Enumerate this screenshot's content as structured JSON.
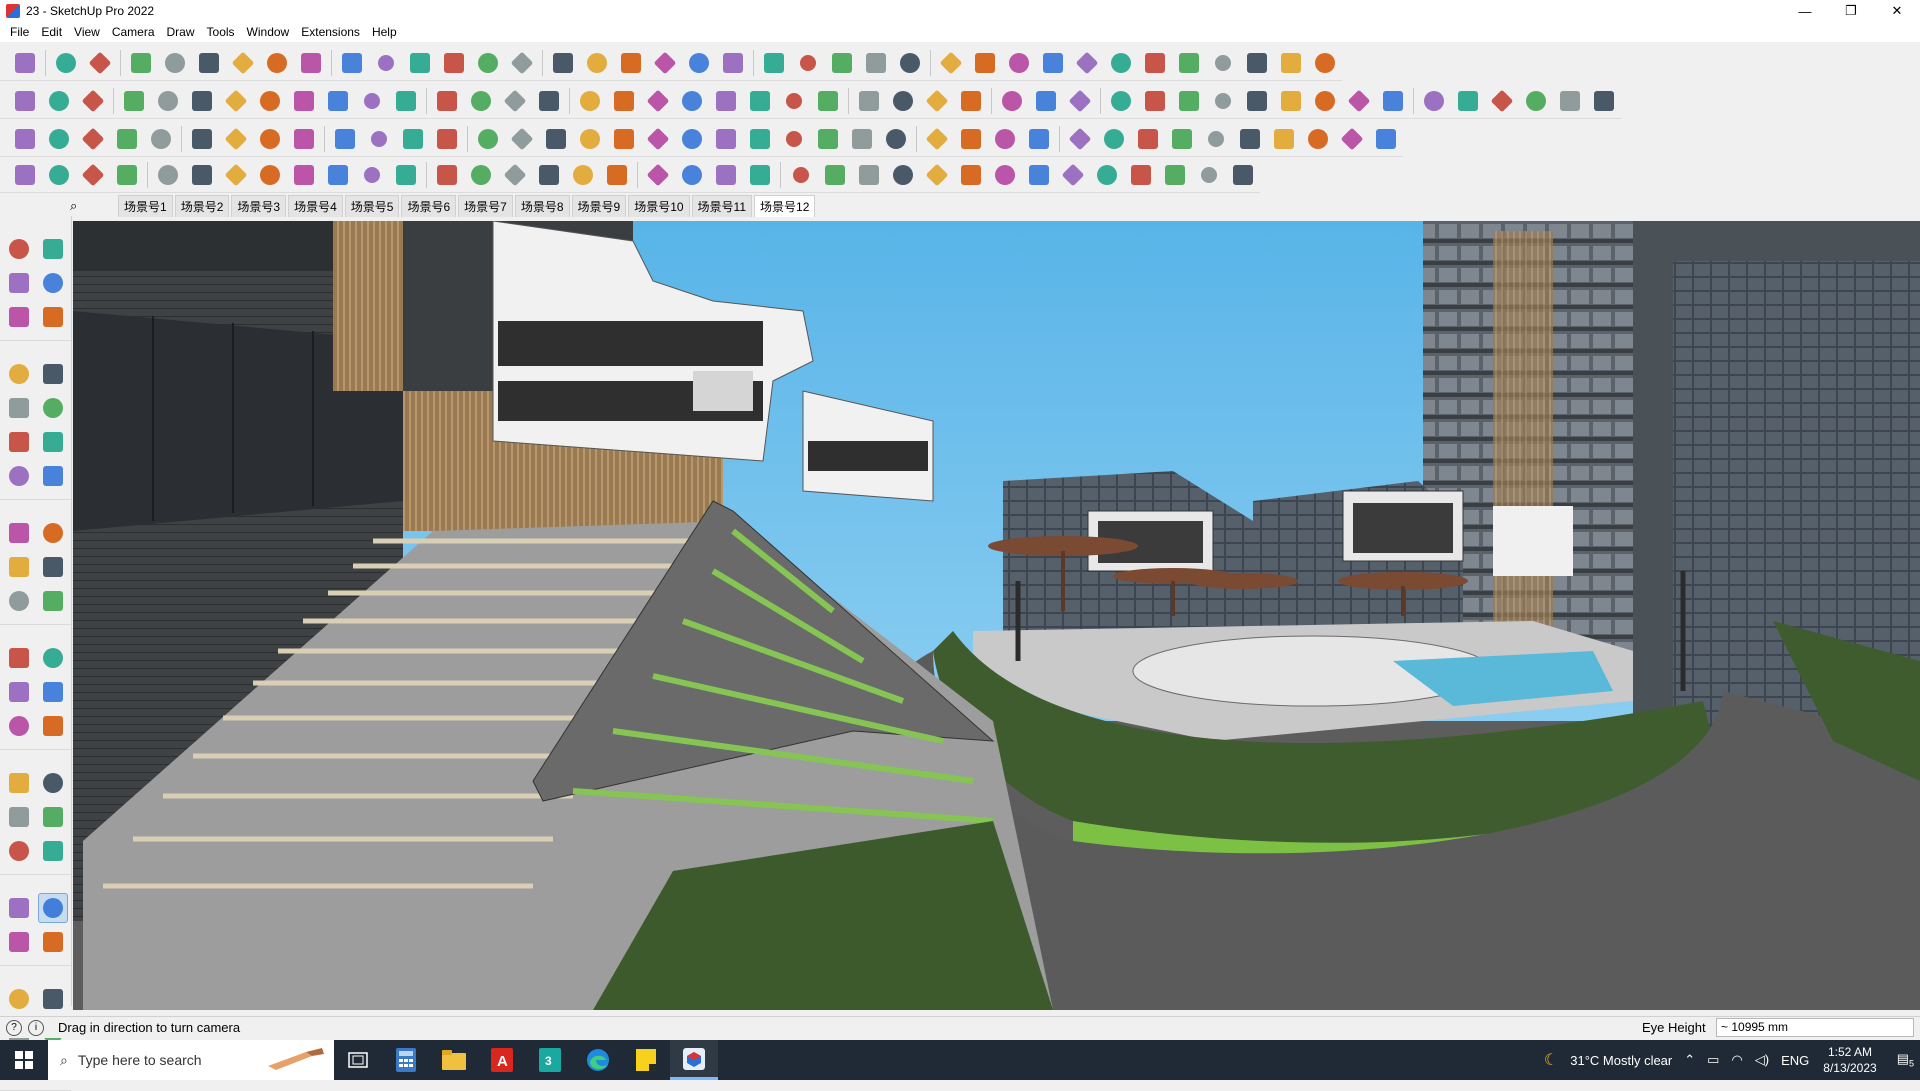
{
  "window": {
    "title": "23 - SketchUp Pro 2022",
    "minimize": "—",
    "maximize": "❐",
    "close": "✕"
  },
  "menu": [
    "File",
    "Edit",
    "View",
    "Camera",
    "Draw",
    "Tools",
    "Window",
    "Extensions",
    "Help"
  ],
  "scenes": {
    "tabs": [
      "场景号1",
      "场景号2",
      "场景号3",
      "场景号4",
      "场景号5",
      "场景号6",
      "场景号7",
      "场景号8",
      "场景号9",
      "场景号10",
      "场景号11",
      "场景号12"
    ],
    "active_index": 11
  },
  "status": {
    "message": "Drag in direction to turn camera",
    "measurement_label": "Eye Height",
    "measurement_value": "~ 10995 mm"
  },
  "taskbar": {
    "search_placeholder": "Type here to search",
    "weather": "31°C  Mostly clear",
    "language": "ENG",
    "time": "1:52 AM",
    "date": "8/13/2023",
    "notification_count": "5"
  },
  "colors": {
    "sky": "#6cc0ec",
    "grass": "#3d5a2c",
    "road": "#595959",
    "taskbar": "#1f2a36"
  }
}
